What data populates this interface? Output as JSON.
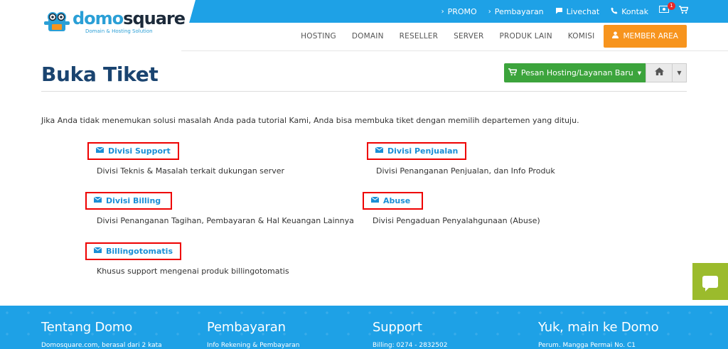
{
  "brand": {
    "name_part1": "domo",
    "name_part2": "square",
    "tagline": "Domain & Hosting Solution"
  },
  "topbar": {
    "links": [
      {
        "label": "PROMO",
        "icon": "chevron-right-icon"
      },
      {
        "label": "Pembayaran",
        "icon": "chevron-right-icon"
      },
      {
        "label": "Livechat",
        "icon": "chat-icon"
      },
      {
        "label": "Kontak",
        "icon": "phone-icon"
      }
    ],
    "badge_count": "1"
  },
  "nav": {
    "items": [
      "HOSTING",
      "DOMAIN",
      "RESELLER",
      "SERVER",
      "PRODUK LAIN",
      "KOMISI"
    ],
    "member_label": "MEMBER AREA"
  },
  "page": {
    "title": "Buka Tiket",
    "order_button": "Pesan Hosting/Layanan Baru",
    "intro": "Jika Anda tidak menemukan solusi masalah Anda pada tutorial Kami, Anda bisa membuka tiket dengan memilih departemen yang dituju."
  },
  "departments": [
    {
      "name": "Divisi Support",
      "desc": "Divisi Teknis & Masalah terkait dukungan server"
    },
    {
      "name": "Divisi Penjualan",
      "desc": "Divisi Penanganan Penjualan, dan Info Produk"
    },
    {
      "name": "Divisi Billing",
      "desc": "Divisi Penanganan Tagihan, Pembayaran & Hal Keuangan Lainnya"
    },
    {
      "name": "Abuse",
      "desc": "Divisi Pengaduan Penyalahgunaan (Abuse)"
    },
    {
      "name": "Billingotomatis",
      "desc": "Khusus support mengenai produk billingotomatis"
    }
  ],
  "footer": {
    "columns": [
      {
        "title": "Tentang Domo",
        "text": "Domosquare.com, berasal dari 2 kata"
      },
      {
        "title": "Pembayaran",
        "text": "Info Rekening & Pembayaran"
      },
      {
        "title": "Support",
        "text": "Billing: 0274 - 2832502"
      },
      {
        "title": "Yuk, main ke Domo",
        "text": "Perum. Mangga Permai No. C1"
      }
    ]
  },
  "colors": {
    "primary": "#1ea1e6",
    "accent_orange": "#f7941d",
    "green_button": "#3ca43c",
    "title_blue": "#1a4470",
    "chat_green": "#9bbb2c"
  }
}
